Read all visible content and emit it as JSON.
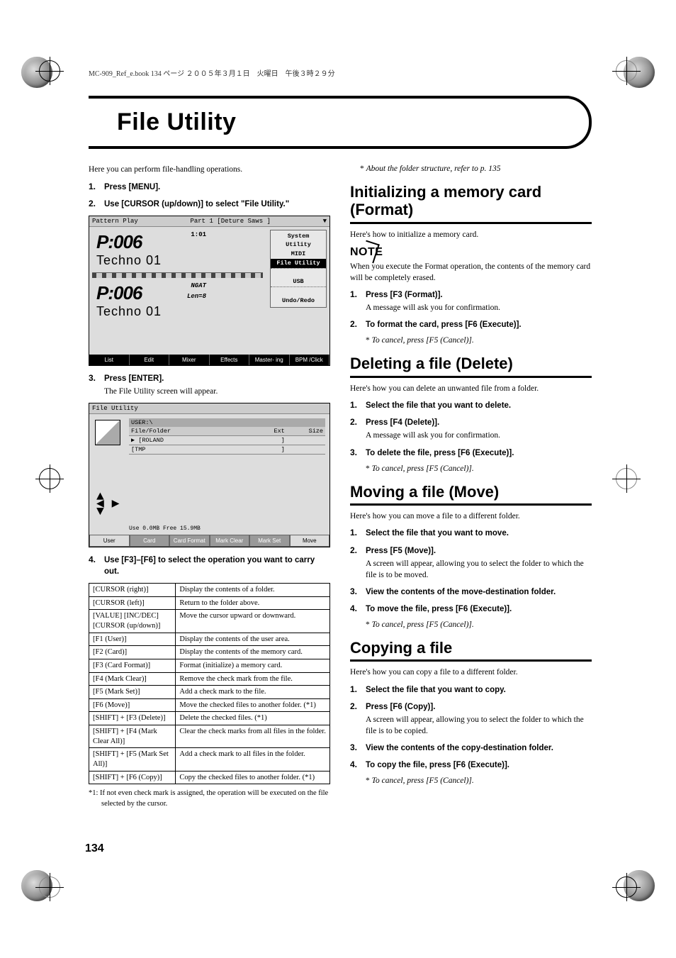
{
  "meta": {
    "header": "MC-909_Ref_e.book  134 ページ  ２００５年３月１日　火曜日　午後３時２９分"
  },
  "page": {
    "title": "File Utility",
    "number": "134"
  },
  "left": {
    "intro": "Here you can perform file-handling operations.",
    "steps1": [
      {
        "n": "1.",
        "b": "Press [MENU]."
      },
      {
        "n": "2.",
        "b": "Use [CURSOR (up/down)] to select \"File Utility.\""
      }
    ],
    "shot1": {
      "bar_left": "Pattern Play",
      "bar_mid": "Part  1    [Deture Saws ]",
      "menu": [
        "System",
        "Utility",
        "MIDI",
        "File Utility",
        "",
        "USB",
        "",
        "Undo/Redo"
      ],
      "lcd_top_code": "P:006",
      "lcd_top_right": "1:01",
      "lcd_top_name": "Techno 01",
      "lcd_bot_right_a": "NGAT",
      "lcd_bot_right_b": "Len=8",
      "strip": [
        "List",
        "Edit",
        "Mixer",
        "Effects",
        "Master-\ning",
        "BPM\n/Click"
      ]
    },
    "steps2": [
      {
        "n": "3.",
        "b": "Press [ENTER].",
        "s": "The File Utility screen will appear."
      }
    ],
    "shot2": {
      "title": "File Utility",
      "path": "USER:\\",
      "cols": [
        "File/Folder",
        "Ext",
        "Size"
      ],
      "rows": [
        [
          "▶  [ROLAND",
          "]",
          ""
        ],
        [
          "    [TMP",
          "]",
          ""
        ]
      ],
      "status": "Use 0.0MB   Free 15.9MB",
      "fkeys": [
        "User",
        "Card",
        "Card\nFormat",
        "Mark\nClear",
        "Mark\nSet",
        "Move"
      ]
    },
    "steps3": [
      {
        "n": "4.",
        "b": "Use [F3]–[F6] to select the operation you want to carry out."
      }
    ],
    "table": [
      [
        "[CURSOR (right)]",
        "Display the contents of a folder."
      ],
      [
        "[CURSOR (left)]",
        "Return to the folder above."
      ],
      [
        "[VALUE] [INC/DEC] [CURSOR (up/down)]",
        "Move the cursor upward or downward."
      ],
      [
        "[F1 (User)]",
        "Display the contents of the user area."
      ],
      [
        "[F2 (Card)]",
        "Display the contents of the memory card."
      ],
      [
        "[F3 (Card Format)]",
        "Format (initialize) a memory card."
      ],
      [
        "[F4 (Mark Clear)]",
        "Remove the check mark from the file."
      ],
      [
        "[F5 (Mark Set)]",
        "Add a check mark to the file."
      ],
      [
        "[F6 (Move)]",
        "Move the checked files to another folder. (*1)"
      ],
      [
        "[SHIFT] + [F3 (Delete)]",
        "Delete the checked files. (*1)"
      ],
      [
        "[SHIFT] + [F4 (Mark Clear All)]",
        "Clear the check marks from all files in the folder."
      ],
      [
        "[SHIFT] + [F5 (Mark Set All)]",
        "Add a check mark to all files in the folder."
      ],
      [
        "[SHIFT] + [F6 (Copy)]",
        "Copy the checked files to another folder. (*1)"
      ]
    ],
    "footnote": "*1:   If not even check mark is assigned, the operation will be executed on the file selected by the cursor."
  },
  "right": {
    "top_note": "About the folder structure, refer to p. 135",
    "sections": [
      {
        "h": "Initializing a memory card (Format)",
        "intro": "Here's how to initialize a memory card.",
        "note": "When you execute the Format operation, the contents of the memory card will be completely erased.",
        "steps": [
          {
            "n": "1.",
            "b": "Press [F3 (Format)].",
            "s": "A message will ask you for confirmation."
          },
          {
            "n": "2.",
            "b": "To format the card, press [F6 (Execute)]."
          }
        ],
        "cancel": "To cancel, press [F5 (Cancel)]."
      },
      {
        "h": "Deleting a file (Delete)",
        "intro": "Here's how you can delete an unwanted file from a folder.",
        "steps": [
          {
            "n": "1.",
            "b": "Select the file that you want to delete."
          },
          {
            "n": "2.",
            "b": "Press [F4 (Delete)].",
            "s": "A message will ask you for confirmation."
          },
          {
            "n": "3.",
            "b": "To delete the file, press [F6 (Execute)]."
          }
        ],
        "cancel": "To cancel, press [F5 (Cancel)]."
      },
      {
        "h": "Moving a file (Move)",
        "intro": "Here's how you can move a file to a different folder.",
        "steps": [
          {
            "n": "1.",
            "b": "Select the file that you want to move."
          },
          {
            "n": "2.",
            "b": "Press [F5 (Move)].",
            "s": "A screen will appear, allowing you to select the folder to which the file is to be moved."
          },
          {
            "n": "3.",
            "b": "View the contents of the move-destination folder."
          },
          {
            "n": "4.",
            "b": "To move the file, press [F6 (Execute)]."
          }
        ],
        "cancel": "To cancel, press [F5 (Cancel)]."
      },
      {
        "h": "Copying a file",
        "intro": "Here's how you can copy a file to a different folder.",
        "steps": [
          {
            "n": "1.",
            "b": "Select the file that you want to copy."
          },
          {
            "n": "2.",
            "b": "Press [F6 (Copy)].",
            "s": "A screen will appear, allowing you to select the folder to which the file is to be copied."
          },
          {
            "n": "3.",
            "b": "View the contents of the copy-destination folder."
          },
          {
            "n": "4.",
            "b": "To copy the file, press [F6 (Execute)]."
          }
        ],
        "cancel": "To cancel, press [F5 (Cancel)]."
      }
    ]
  }
}
